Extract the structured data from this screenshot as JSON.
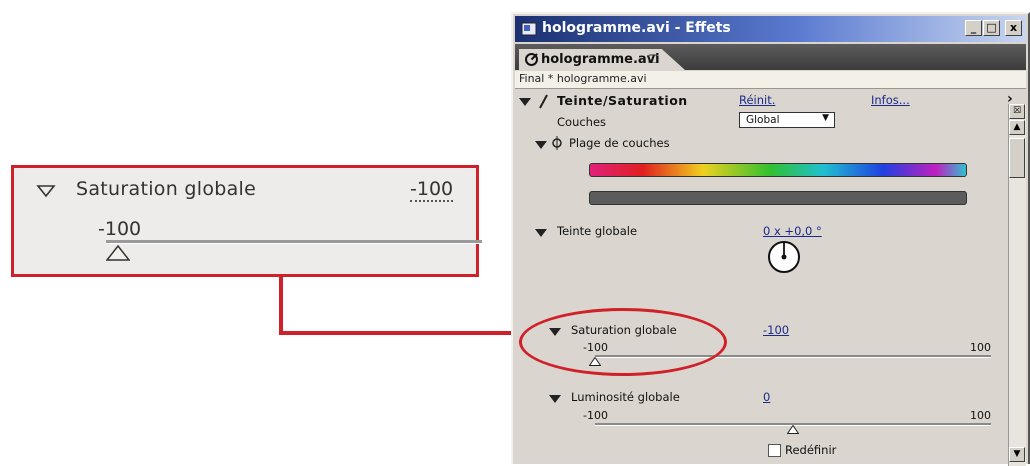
{
  "window": {
    "title": "hologramme.avi - Effets",
    "tab_label": "hologramme.avi",
    "tab_close": "❐",
    "composition_label": "Final * hologramme.avi",
    "btn_min": "_",
    "btn_max": "□",
    "btn_close": "x"
  },
  "effect": {
    "name": "Teinte/Saturation",
    "reset_label": "Réinit.",
    "about_label": "Infos..."
  },
  "channel": {
    "label": "Couches",
    "value": "Global"
  },
  "channel_range": {
    "label": "Plage de couches"
  },
  "hue": {
    "label": "Teinte globale",
    "value": "0 x +0,0 °"
  },
  "saturation": {
    "label": "Saturation globale",
    "value": "-100",
    "slider_min": "-100",
    "slider_max": "100",
    "level": -100
  },
  "lightness": {
    "label": "Luminosité globale",
    "value": "0",
    "slider_min": "-100",
    "slider_max": "100",
    "level": 0
  },
  "colorize": {
    "label": "Redéfinir",
    "checked": false
  },
  "zoom": {
    "title": "Saturation globale",
    "value": "-100",
    "slider_min": "-100"
  },
  "colors": {
    "accent": "#d0202a",
    "title_bar_start": "#1a3070",
    "panel_bg": "#dad6cf",
    "link": "#1a2a8a"
  }
}
